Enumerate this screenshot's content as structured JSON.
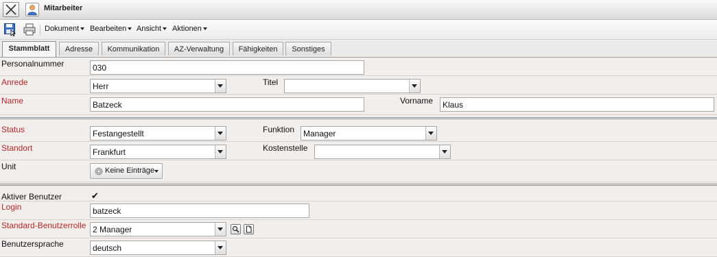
{
  "window": {
    "title": "Mitarbeiter",
    "close_icon": "close-icon",
    "app_icon": "user-icon"
  },
  "toolbar": {
    "save_icon": "save-icon",
    "print_icon": "print-icon",
    "menus": [
      "Dokument",
      "Bearbeiten",
      "Ansicht",
      "Aktionen"
    ]
  },
  "tabs": [
    "Stammblatt",
    "Adresse",
    "Kommunikation",
    "AZ-Verwaltung",
    "Fähigkeiten",
    "Sonstiges"
  ],
  "active_tab": "Stammblatt",
  "form": {
    "personalnummer": {
      "label": "Personalnummer",
      "value": "030"
    },
    "anrede": {
      "label": "Anrede",
      "value": "Herr"
    },
    "titel": {
      "label": "Titel",
      "value": ""
    },
    "name": {
      "label": "Name",
      "value": "Batzeck"
    },
    "vorname": {
      "label": "Vorname",
      "value": "Klaus"
    },
    "status": {
      "label": "Status",
      "value": "Festangestellt"
    },
    "funktion": {
      "label": "Funktion",
      "value": "Manager"
    },
    "standort": {
      "label": "Standort",
      "value": "Frankfurt"
    },
    "kostenstelle": {
      "label": "Kostenstelle",
      "value": ""
    },
    "unit": {
      "label": "Unit",
      "button_label": "Keine Einträge"
    },
    "aktiver_benutzer": {
      "label": "Aktiver Benutzer",
      "checked": true,
      "check_glyph": "✔"
    },
    "login": {
      "label": "Login",
      "value": "batzeck"
    },
    "benutzerrolle": {
      "label": "Standard-Benutzerrolle",
      "value": "2 Manager",
      "search_icon": "magnifier-icon",
      "open_icon": "document-icon"
    },
    "benutzersprache": {
      "label": "Benutzersprache",
      "value": "deutsch"
    }
  },
  "colors": {
    "required_label": "#b52626",
    "background": "#f1eeec"
  }
}
